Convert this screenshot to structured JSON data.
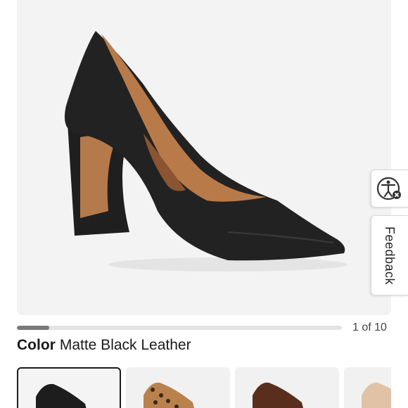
{
  "product": {
    "image": {
      "description_icon": "black-block-heel-pump-image"
    },
    "gallery": {
      "counter": "1 of 10",
      "progress_fraction": 0.1
    },
    "color": {
      "label": "Color",
      "value": "Matte Black Leather"
    },
    "swatches": [
      {
        "icon": "matte-black-swatch",
        "selected": true
      },
      {
        "icon": "leopard-print-swatch",
        "selected": false
      },
      {
        "icon": "brown-leather-swatch",
        "selected": false
      },
      {
        "icon": "nude-swatch",
        "selected": false
      }
    ]
  },
  "side_tabs": {
    "accessibility_icon": "accessibility-icon",
    "feedback_label": "Feedback"
  }
}
